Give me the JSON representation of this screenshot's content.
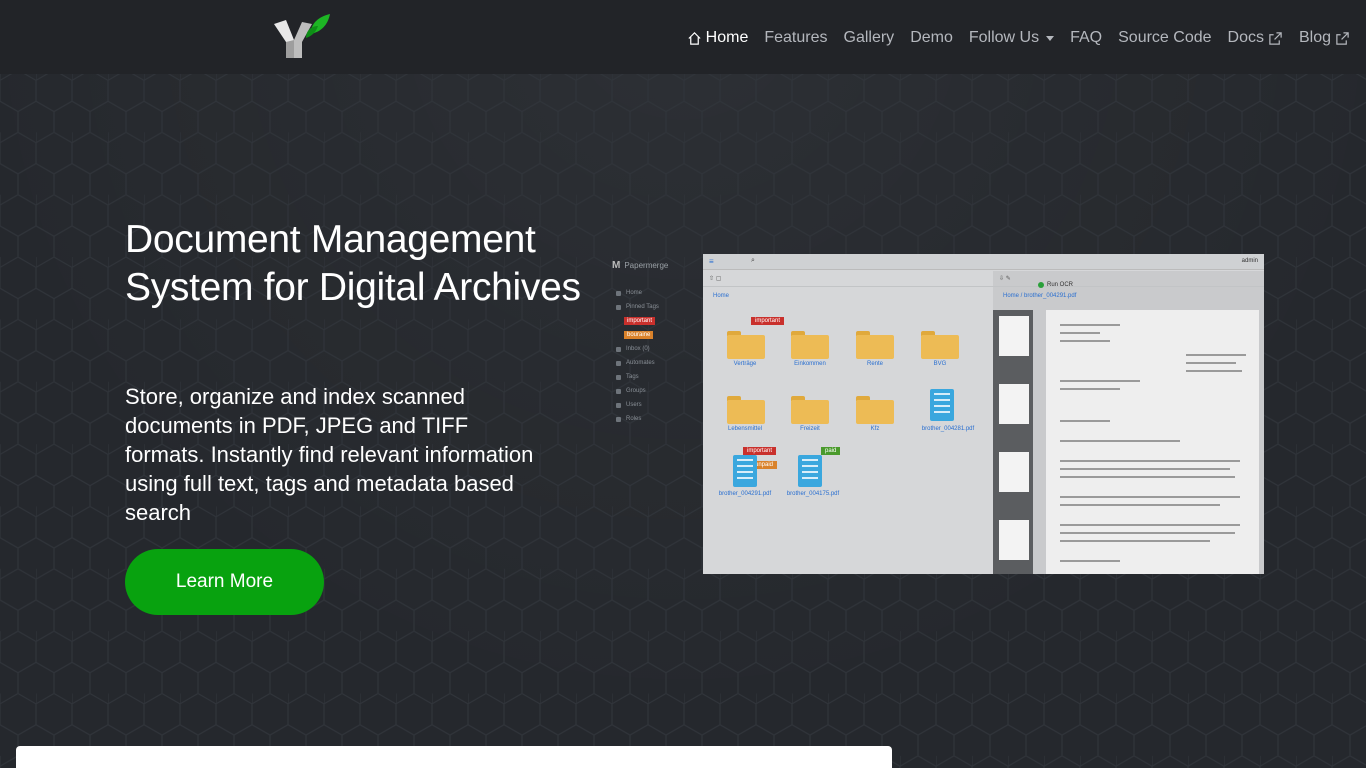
{
  "nav": {
    "items": [
      {
        "label": "Home",
        "active": true,
        "icon": "house-icon"
      },
      {
        "label": "Features"
      },
      {
        "label": "Gallery"
      },
      {
        "label": "Demo"
      },
      {
        "label": "Follow Us",
        "dropdown": true
      },
      {
        "label": "FAQ"
      },
      {
        "label": "Source Code"
      },
      {
        "label": "Docs",
        "icon": "external-link-icon"
      },
      {
        "label": "Blog",
        "icon": "external-link-icon"
      }
    ]
  },
  "hero": {
    "title": "Document Management System for Digital Archives",
    "subtitle": "Store, organize and index scanned documents in PDF, JPEG and TIFF formats. Instantly find relevant information using full text, tags and metadata based search",
    "cta_label": "Learn More"
  },
  "screenshot": {
    "brand": "Papermerge",
    "sidebar": [
      "Home",
      "Pinned Tags",
      "Inbox (0)",
      "Automates",
      "Tags",
      "Groups",
      "Users",
      "Roles"
    ],
    "pinned_tags": [
      {
        "label": "important",
        "color": "#c9302c"
      },
      {
        "label": "bouraine",
        "color": "#d9822b"
      }
    ],
    "user": "admin",
    "run_ocr": "Run OCR",
    "left_crumb": "Home",
    "right_crumb": "Home / brother_004291.pdf",
    "folders": [
      "Verträge",
      "Einkommen",
      "Rente",
      "BVG",
      "Lebensmittel",
      "Freizeit",
      "Kfz"
    ],
    "docs": [
      "brother_004281.pdf",
      "brother_004291.pdf",
      "brother_004175.pdf"
    ],
    "doc_tags": {
      "important": "important",
      "unpaid": "unpaid",
      "paid": "paid"
    }
  },
  "colors": {
    "background": "#25282d",
    "accent": "#08a20f",
    "link": "#2a6fd0"
  }
}
